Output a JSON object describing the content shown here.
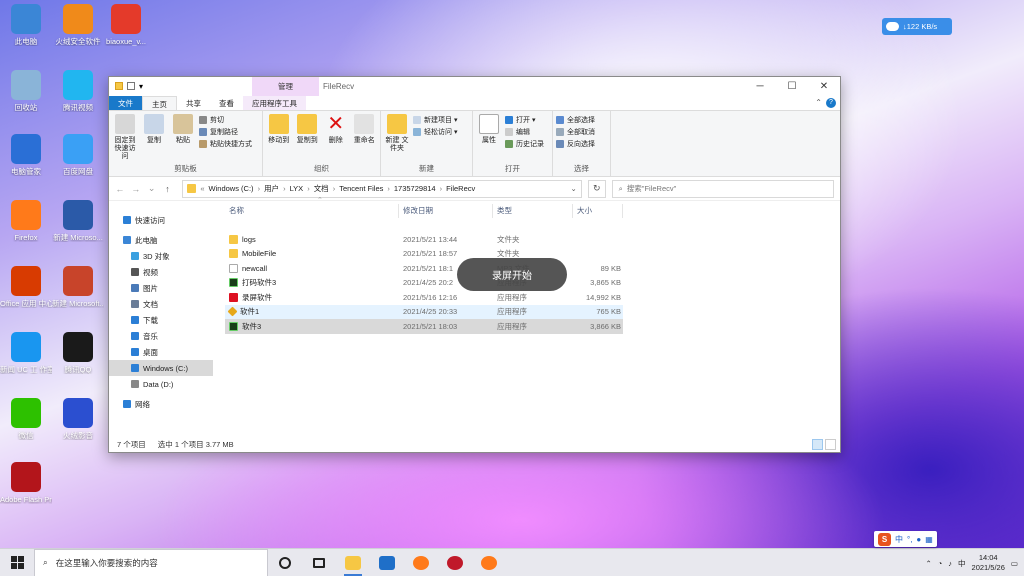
{
  "desktop": {
    "icons": [
      {
        "label": "此电脑",
        "icon": "computer-icon",
        "color": "#3b86d6"
      },
      {
        "label": "火绒安全软件",
        "icon": "huorong-icon",
        "color": "#f08a1a"
      },
      {
        "label": "biaoxue_v...",
        "icon": "biaoxue-icon",
        "color": "#e43a2a"
      },
      {
        "label": "回收站",
        "icon": "recycle-bin-icon",
        "color": "#8ab4d8"
      },
      {
        "label": "腾讯视频",
        "icon": "tencent-video-icon",
        "color": "#21b6f0"
      },
      {
        "label": "电脑管家",
        "icon": "pc-manager-icon",
        "color": "#2a6fd6"
      },
      {
        "label": "百度网盘",
        "icon": "baidu-netdisk-icon",
        "color": "#3aa0f5"
      },
      {
        "label": "Firefox",
        "icon": "firefox-icon",
        "color": "#ff7a1a"
      },
      {
        "label": "新建 Microso...",
        "icon": "word-icon",
        "color": "#2b5aa8"
      },
      {
        "label": "Office 应用 中心",
        "icon": "office-icon",
        "color": "#d83b01"
      },
      {
        "label": "新建 Microsoft...",
        "icon": "powerpoint-icon",
        "color": "#c8442a"
      },
      {
        "label": "新闻 UC 工 作室",
        "icon": "news-icon",
        "color": "#1996f0"
      },
      {
        "label": "腾讯QQ",
        "icon": "qq-icon",
        "color": "#1a1a1a"
      },
      {
        "label": "微信",
        "icon": "wechat-icon",
        "color": "#2dc100"
      },
      {
        "label": "火绒影音",
        "icon": "media-player-icon",
        "color": "#2b4fd0"
      },
      {
        "label": "Adobe Flash Profession...",
        "icon": "flash-icon",
        "color": "#b3151b"
      }
    ]
  },
  "network_widget": {
    "speed": "↓122 KB/s"
  },
  "window": {
    "title": "FileRecv",
    "context_group": "管理",
    "controls": {
      "minimize": "─",
      "maximize": "☐",
      "close": "✕"
    },
    "tabs": [
      "文件",
      "主页",
      "共享",
      "查看",
      "应用程序工具"
    ],
    "help": "?",
    "ribbon": {
      "clipboard": {
        "name": "剪贴板",
        "pin": "固定到 快速访问",
        "copy": "复制",
        "paste": "粘贴",
        "cut": "剪切",
        "copy_path": "复制路径",
        "paste_shortcut": "粘贴快捷方式"
      },
      "organize": {
        "name": "组织",
        "move_to": "移动到",
        "copy_to": "复制到",
        "delete": "删除",
        "rename": "重命名"
      },
      "new": {
        "name": "新建",
        "new_folder": "新建 文件夹",
        "new_item": "新建项目 ▾",
        "easy_access": "轻松访问 ▾"
      },
      "open": {
        "name": "打开",
        "properties": "属性",
        "open": "打开 ▾",
        "edit": "编辑",
        "history": "历史记录"
      },
      "select": {
        "name": "选择",
        "select_all": "全部选择",
        "select_none": "全部取消",
        "invert": "反向选择"
      }
    },
    "address": {
      "path": [
        "Windows (C:)",
        "用户",
        "LYX",
        "文档",
        "Tencent Files",
        "1735729814",
        "FileRecv"
      ],
      "search_placeholder": "搜索\"FileRecv\""
    },
    "nav": [
      {
        "label": "快速访问",
        "indent": 0,
        "icon": "star-icon",
        "color": "#2b7fd6"
      },
      {
        "label": "此电脑",
        "indent": 0,
        "icon": "computer-icon",
        "color": "#3b86d6"
      },
      {
        "label": "3D 对象",
        "indent": 1,
        "icon": "3d-objects-icon",
        "color": "#3aa0e0"
      },
      {
        "label": "视频",
        "indent": 1,
        "icon": "video-icon",
        "color": "#555"
      },
      {
        "label": "图片",
        "indent": 1,
        "icon": "pictures-icon",
        "color": "#4a7ab8"
      },
      {
        "label": "文档",
        "indent": 1,
        "icon": "documents-icon",
        "color": "#6a7d98"
      },
      {
        "label": "下载",
        "indent": 1,
        "icon": "download-icon",
        "color": "#2b7fd6"
      },
      {
        "label": "音乐",
        "indent": 1,
        "icon": "music-icon",
        "color": "#2b7fd6"
      },
      {
        "label": "桌面",
        "indent": 1,
        "icon": "desktop-icon",
        "color": "#2b7fd6"
      },
      {
        "label": "Windows (C:)",
        "indent": 1,
        "icon": "drive-icon",
        "color": "#2b7fd6",
        "selected": true
      },
      {
        "label": "Data (D:)",
        "indent": 1,
        "icon": "drive-icon",
        "color": "#888"
      },
      {
        "label": "网络",
        "indent": 0,
        "icon": "network-icon",
        "color": "#2b7fd6"
      }
    ],
    "columns": [
      "名称",
      "修改日期",
      "类型",
      "大小"
    ],
    "files": [
      {
        "name": "logs",
        "date": "2021/5/21 13:44",
        "type": "文件夹",
        "size": "",
        "icon": "folder"
      },
      {
        "name": "MobileFile",
        "date": "2021/5/21 18:57",
        "type": "文件夹",
        "size": "",
        "icon": "folder"
      },
      {
        "name": "newcall",
        "date": "2021/5/21 18:1",
        "type": "MP3 文件",
        "size": "89 KB",
        "icon": "doc"
      },
      {
        "name": "打码软件3",
        "date": "2021/4/25 20:2",
        "type": "应用程序",
        "size": "3,865 KB",
        "icon": "g"
      },
      {
        "name": "录屏软件",
        "date": "2021/5/16 12:16",
        "type": "应用程序",
        "size": "14,992 KB",
        "icon": "rec"
      },
      {
        "name": "软件1",
        "date": "2021/4/25 20:33",
        "type": "应用程序",
        "size": "765 KB",
        "icon": "pen",
        "state": "hover"
      },
      {
        "name": "软件3",
        "date": "2021/5/21 18:03",
        "type": "应用程序",
        "size": "3,866 KB",
        "icon": "g",
        "state": "selected"
      }
    ],
    "status": {
      "count": "7 个项目",
      "selected": "选中 1 个项目 3.77 MB"
    }
  },
  "toast": "录屏开始",
  "taskbar": {
    "search_placeholder": "在这里输入你要搜索的内容",
    "apps": [
      {
        "icon": "cortana-icon",
        "color": "#222"
      },
      {
        "icon": "task-view-icon",
        "color": "#222"
      },
      {
        "icon": "file-explorer-icon",
        "color": "#f6c744",
        "active": true
      },
      {
        "icon": "mail-icon",
        "color": "#1f6fc8"
      },
      {
        "icon": "firefox-icon",
        "color": "#ff7a1a"
      },
      {
        "icon": "record-app-icon",
        "color": "#c0192a"
      },
      {
        "icon": "firefox-icon",
        "color": "#ff7a1a"
      }
    ],
    "ime": {
      "logo": "S",
      "lang": "中"
    },
    "clock": {
      "time": "14:04",
      "date": "2021/5/26"
    }
  }
}
